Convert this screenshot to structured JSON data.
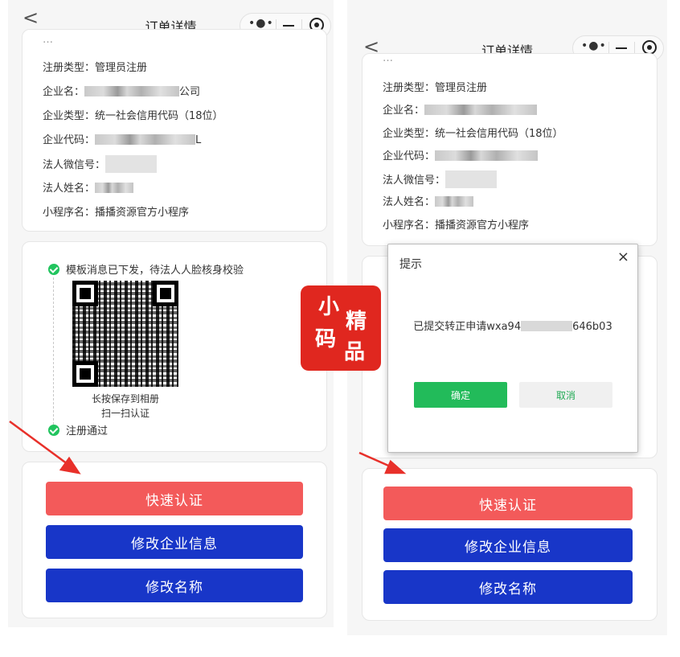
{
  "left": {
    "nav": {
      "title": "订单详情",
      "back": "<",
      "more": "•●•"
    },
    "info": {
      "partial_top": "…",
      "reg_type_label": "注册类型：",
      "reg_type_value": "管理员注册",
      "company_label": "企业名：",
      "company_suffix": "公司",
      "company_type_label": "企业类型：",
      "company_type_value": "统一社会信用代码（18位）",
      "company_code_label": "企业代码：",
      "company_code_suffix": "L",
      "wechat_label": "法人微信号：",
      "name_label": "法人姓名：",
      "miniapp_label": "小程序名：",
      "miniapp_value": "播播资源官方小程序"
    },
    "steps": {
      "step1": "模板消息已下发，待法人人脸核身校验",
      "qr_caption_1": "长按保存到相册",
      "qr_caption_2": "扫一扫认证",
      "step2": "注册通过"
    },
    "buttons": {
      "quick_verify": "快速认证",
      "edit_company": "修改企业信息",
      "edit_name": "修改名称"
    }
  },
  "right": {
    "nav": {
      "title": "订单详情",
      "back": "<",
      "more": "•●•"
    },
    "info": {
      "partial_top": "…",
      "reg_type_label": "注册类型：",
      "reg_type_value": "管理员注册",
      "company_label": "企业名：",
      "company_type_label": "企业类型：",
      "company_type_value": "统一社会信用代码（18位）",
      "company_code_label": "企业代码：",
      "wechat_label": "法人微信号：",
      "name_label": "法人姓名：",
      "miniapp_label": "小程序名：",
      "miniapp_value": "播播资源官方小程序"
    },
    "dialog": {
      "title": "提示",
      "close": "×",
      "message_prefix": "已提交转正申请wxa94",
      "message_suffix": "646b03",
      "ok": "确定",
      "cancel": "取消"
    },
    "buttons": {
      "quick_verify": "快速认证",
      "edit_company": "修改企业信息",
      "edit_name": "修改名称"
    }
  },
  "stamp": {
    "chars": [
      "小",
      "精",
      "码",
      "品"
    ]
  },
  "colors": {
    "red_button": "#f35a5a",
    "blue_button": "#1836c8",
    "check_green": "#21c45e",
    "dialog_ok": "#22bb5a",
    "stamp_red": "#e0271f",
    "arrow_red": "#e8302a"
  }
}
